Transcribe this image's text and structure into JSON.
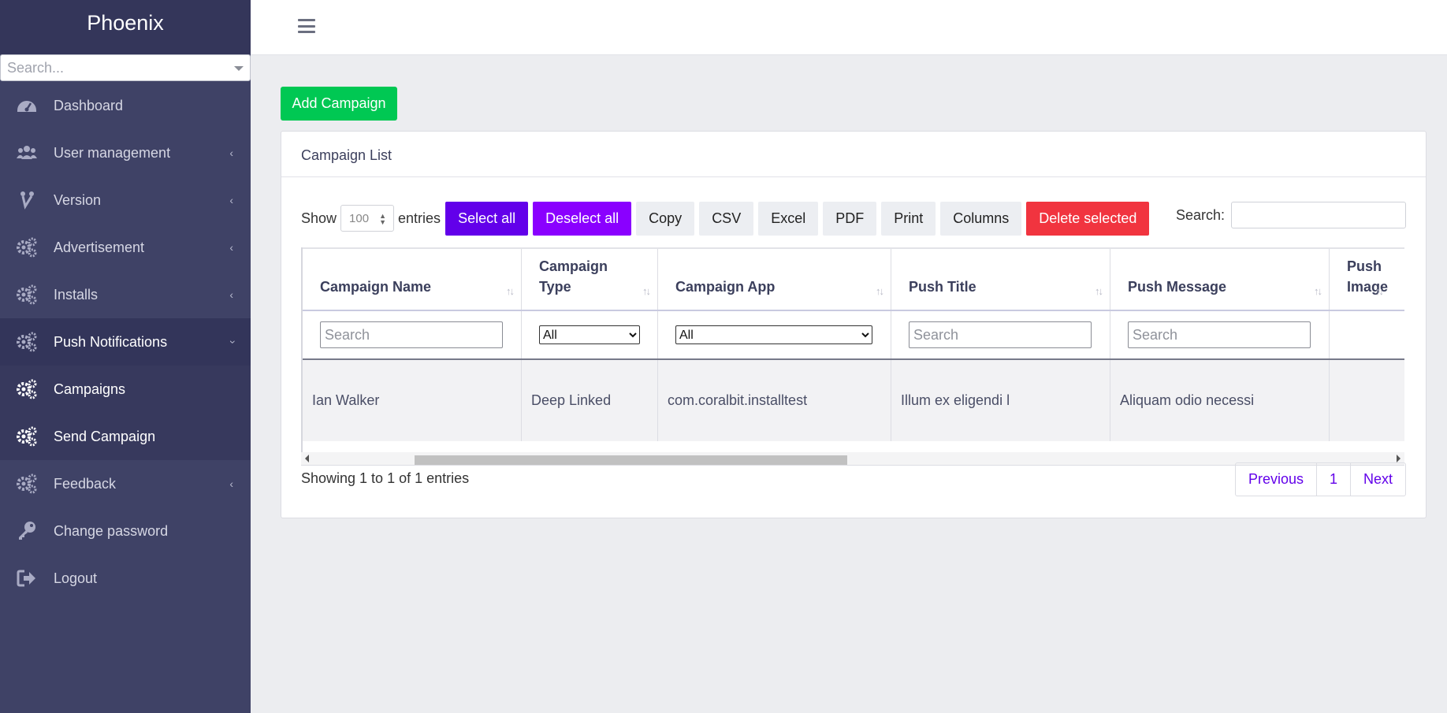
{
  "brand": "Phoenix",
  "sidebar": {
    "search_placeholder": "Search...",
    "items": [
      {
        "label": "Dashboard",
        "icon": "dashboard-icon"
      },
      {
        "label": "User management",
        "icon": "users-icon"
      },
      {
        "label": "Version",
        "icon": "version-icon"
      },
      {
        "label": "Advertisement",
        "icon": "gears-icon"
      },
      {
        "label": "Installs",
        "icon": "gears-icon"
      },
      {
        "label": "Push Notifications",
        "icon": "gears-icon"
      },
      {
        "label": "Campaigns",
        "icon": "gears-icon"
      },
      {
        "label": "Send Campaign",
        "icon": "gears-icon"
      },
      {
        "label": "Feedback",
        "icon": "gears-icon"
      },
      {
        "label": "Change password",
        "icon": "key-icon"
      },
      {
        "label": "Logout",
        "icon": "logout-icon"
      }
    ]
  },
  "main": {
    "add_button": "Add Campaign",
    "card_title": "Campaign List",
    "show_label": "Show",
    "entries_label": "entries",
    "page_length": "100",
    "buttons": {
      "select_all": "Select all",
      "deselect_all": "Deselect all",
      "copy": "Copy",
      "csv": "CSV",
      "excel": "Excel",
      "pdf": "PDF",
      "print": "Print",
      "columns": "Columns",
      "delete_selected": "Delete selected"
    },
    "search_label": "Search:",
    "table": {
      "headers": [
        "Campaign Name",
        "Campaign Type",
        "Campaign App",
        "Push Title",
        "Push Message",
        "Push Image"
      ],
      "filter_placeholder": "Search",
      "filter_select_value": "All",
      "rows": [
        [
          "Ian Walker",
          "Deep Linked",
          "com.coralbit.installtest",
          "Illum ex eligendi l",
          "Aliquam odio necessi",
          ""
        ]
      ]
    },
    "info": "Showing 1 to 1 of 1 entries",
    "pager": {
      "previous": "Previous",
      "page": "1",
      "next": "Next"
    }
  },
  "colors": {
    "sidebar_bg": "#3f4266",
    "add_button": "#00c853",
    "select_all": "#6200ea",
    "deselect_all": "#8a00ff",
    "delete_selected": "#f1343f"
  }
}
